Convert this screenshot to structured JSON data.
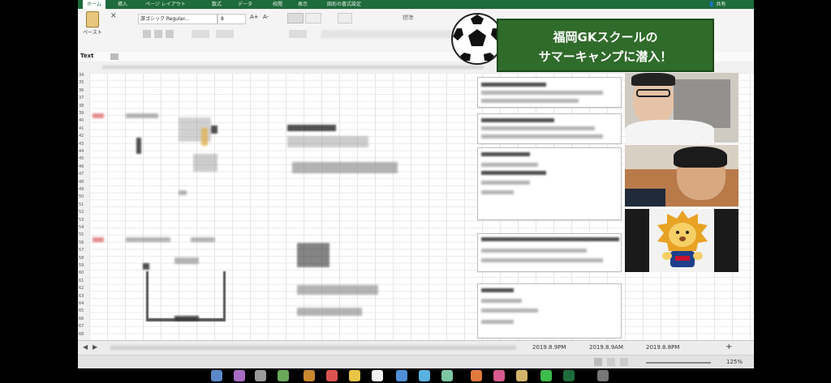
{
  "ribbon": {
    "tabs": [
      "ホーム",
      "挿入",
      "ページ レイアウト",
      "数式",
      "データ",
      "校閲",
      "表示",
      "図形の書式設定"
    ],
    "active_tab": "ホーム",
    "font_name": "游ゴシック Regular...",
    "font_size": "8",
    "paste_label": "ペースト",
    "style_label": "標準",
    "user_label": "共有"
  },
  "formula_bar": {
    "name_box": "Text"
  },
  "sheet_tabs": [
    "2019.8.9PM",
    "2019.8.9AM",
    "2019.8.8PM"
  ],
  "status": {
    "zoom": "125%"
  },
  "banner": {
    "line1": "福岡GKスクールの",
    "line2": "サマーキャンプに潜入！"
  },
  "row_numbers": [
    "34",
    "35",
    "36",
    "37",
    "38",
    "39",
    "40",
    "41",
    "42",
    "43",
    "44",
    "45",
    "46",
    "47",
    "48",
    "49",
    "50",
    "51",
    "52",
    "53",
    "54",
    "55",
    "56",
    "57",
    "58",
    "59",
    "60",
    "61",
    "62",
    "63",
    "64",
    "65",
    "66",
    "67",
    "68"
  ],
  "colors": {
    "excel_green": "#1e6b3c",
    "banner_green": "#2f6b2a"
  },
  "participants": [
    "person-with-glasses",
    "young-person",
    "lion-mascot"
  ]
}
